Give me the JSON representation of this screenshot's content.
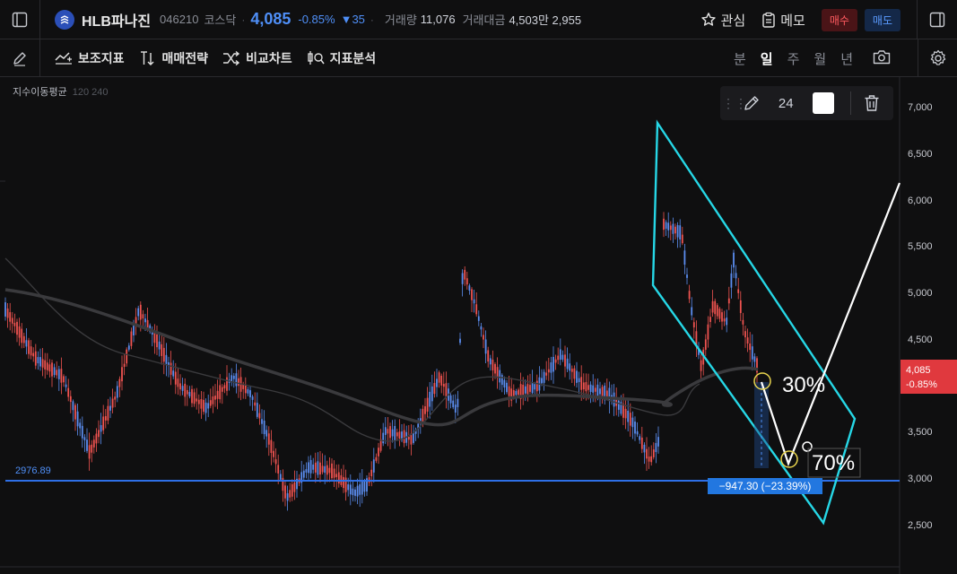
{
  "header": {
    "symbol_name": "HLB파나진",
    "symbol_code": "046210",
    "market": "코스닥",
    "price": "4,085",
    "change_pct": "-0.85%",
    "change_abs": "▼35",
    "volume_label": "거래량",
    "volume_value": "11,076",
    "amount_label": "거래대금",
    "amount_value": "4,503만 2,955",
    "watch_label": "관심",
    "memo_label": "메모",
    "buy_label": "매수",
    "sell_label": "매도"
  },
  "toolbar": {
    "indicator_label": "보조지표",
    "strategy_label": "매매전략",
    "compare_label": "비교차트",
    "analysis_label": "지표분석",
    "periods": [
      "분",
      "일",
      "주",
      "월",
      "년"
    ],
    "active_period": "일"
  },
  "indicator": {
    "name": "지수이동평균",
    "params": "120 240"
  },
  "draw_tool": {
    "line_width": "24",
    "color": "#ffffff"
  },
  "annotations": {
    "hline_value": "2976.89",
    "measure_label": "−947.30 (−23.39%)",
    "pct_30": "30%",
    "pct_70": "70%"
  },
  "price_axis": {
    "ticks": [
      "7,000",
      "6,500",
      "6,000",
      "5,500",
      "5,000",
      "4,500",
      "3,500",
      "3,000",
      "2,500"
    ],
    "current_price": "4,085",
    "current_change": "-0.85%"
  },
  "colors": {
    "up": "#ef5350",
    "down": "#5b8def",
    "accent_line": "#2962ff",
    "channel": "#26d7e6",
    "drawing": "#ffffff"
  }
}
